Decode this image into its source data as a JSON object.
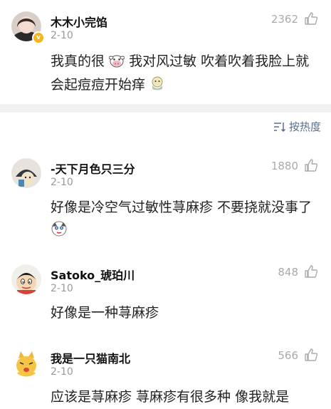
{
  "comment_main": {
    "username": "木木小完馅",
    "date": "2-10",
    "likes": "2362",
    "text_part1": "我真的很",
    "text_part2": " 我对风过敏 吹着吹着我脸上就会起痘痘开始痒",
    "badge_icon": "verified-v-icon"
  },
  "sort_button": {
    "label": "按热度",
    "icon": "sort-icon"
  },
  "replies": [
    {
      "username": "-天下月色只三分",
      "date": "2-10",
      "likes": "1880",
      "text": "好像是冷空气过敏性荨麻疹 不要挠就没事了"
    },
    {
      "username": "Satoko_琥珀川",
      "date": "2-10",
      "likes": "848",
      "text": "好像是一种荨麻疹"
    },
    {
      "username": "我是一只猫南北",
      "date": "2-10",
      "likes": "566",
      "text": "应该是荨麻疹 荨麻疹有很多种 像我就是"
    }
  ],
  "colors": {
    "accent": "#5a6e8c",
    "muted": "#999999",
    "divider": "#f2f2f2",
    "badge": "#f5b51b"
  }
}
